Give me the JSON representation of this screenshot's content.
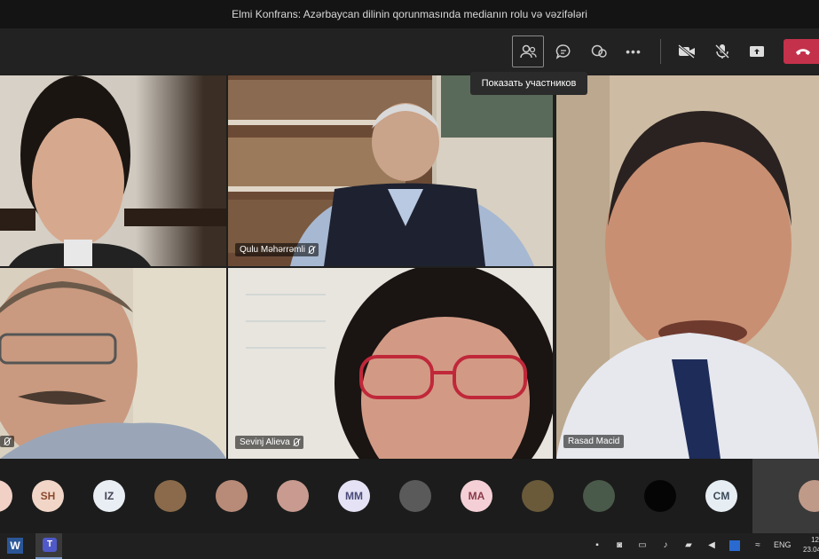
{
  "window": {
    "title": "Elmi Konfrans: Azərbaycan dilinin qorunmasında medianın rolu və vəzifələri"
  },
  "toolbar": {
    "tooltip": "Показать участников",
    "icons": [
      "participants-icon",
      "chat-icon",
      "reactions-icon",
      "more-icon",
      "camera-off-icon",
      "mic-off-icon",
      "share-icon",
      "hangup-icon"
    ],
    "more_label": "•••"
  },
  "tiles": [
    {
      "name": ""
    },
    {
      "name": "Qulu Məhərrəmli"
    },
    {
      "name": "Rasad Macid"
    },
    {
      "name": ""
    },
    {
      "name": "Sevinj Alieva"
    }
  ],
  "roster": {
    "initials": [
      "SH",
      "IZ",
      "MM",
      "MA",
      "CM"
    ]
  },
  "taskbar": {
    "lang": "ENG",
    "time": "12",
    "date": "23.04"
  },
  "colors": {
    "hangup": "#c4314b",
    "bar": "#222222"
  }
}
